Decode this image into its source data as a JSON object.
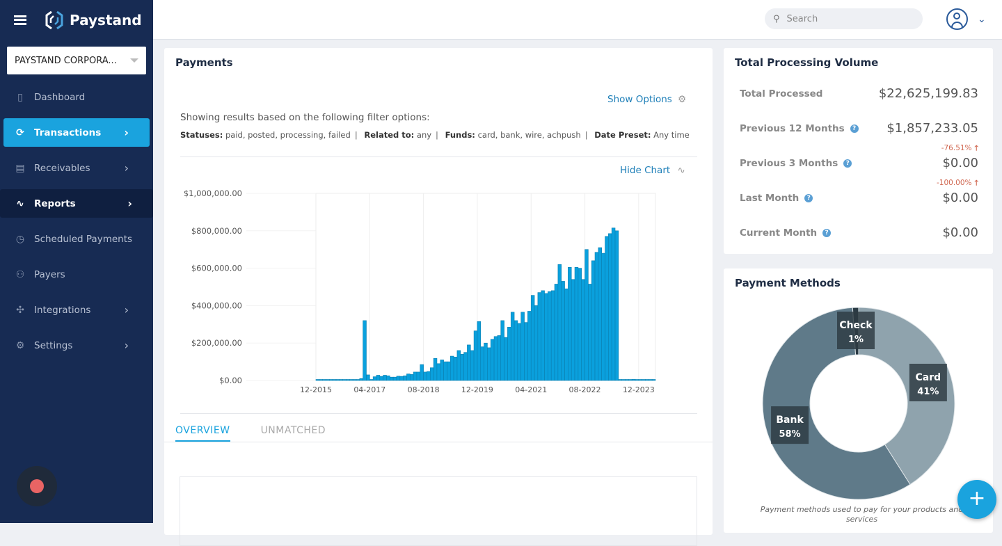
{
  "app": {
    "brand": "Paystand"
  },
  "sidebar": {
    "org_selector": "PAYSTAND CORPORA...",
    "items": [
      {
        "label": "Dashboard",
        "icon": "dashboard-icon"
      },
      {
        "label": "Transactions",
        "icon": "refresh-icon",
        "active": true
      },
      {
        "label": "Receivables",
        "icon": "document-icon"
      },
      {
        "label": "Reports",
        "icon": "activity-icon"
      },
      {
        "label": "Scheduled Payments",
        "icon": "clock-icon"
      },
      {
        "label": "Payers",
        "icon": "users-icon"
      },
      {
        "label": "Integrations",
        "icon": "puzzle-icon"
      },
      {
        "label": "Settings",
        "icon": "gear-icon"
      }
    ]
  },
  "topbar": {
    "search_placeholder": "Search"
  },
  "payments": {
    "title": "Payments",
    "show_options": "Show Options",
    "filter_intro": "Showing results based on the following filter options:",
    "filters": [
      {
        "key": "Statuses:",
        "value": "paid, posted, processing, failed"
      },
      {
        "key": "Related to:",
        "value": "any"
      },
      {
        "key": "Funds:",
        "value": "card, bank, wire, achpush"
      },
      {
        "key": "Date Preset:",
        "value": "Any time"
      }
    ],
    "hide_chart": "Hide Chart",
    "tabs": [
      {
        "label": "OVERVIEW",
        "active": true
      },
      {
        "label": "UNMATCHED"
      }
    ]
  },
  "tpv": {
    "title": "Total Processing Volume",
    "rows": [
      {
        "label": "Total Processed",
        "value": "$22,625,199.83"
      },
      {
        "label": "Previous 12 Months",
        "value": "$1,857,233.05",
        "change": "-76.51%"
      },
      {
        "label": "Previous 3 Months",
        "value": "$0.00",
        "change": "-100.00%"
      },
      {
        "label": "Last Month",
        "value": "$0.00"
      },
      {
        "label": "Current Month",
        "value": "$0.00"
      }
    ]
  },
  "payment_methods": {
    "title": "Payment Methods",
    "caption": "Payment methods used to pay for your products and services"
  },
  "colors": {
    "accent": "#1aa3de",
    "sidebar": "#172b53",
    "bar": "#0aa0dd",
    "negative": "#d0664f"
  },
  "chart_data": [
    {
      "type": "bar",
      "ylim": [
        0,
        1000000
      ],
      "y_ticks": [
        "$0.00",
        "$200,000.00",
        "$400,000.00",
        "$600,000.00",
        "$800,000.00",
        "$1,000,000.00"
      ],
      "x_ticks": [
        "12-2015",
        "04-2017",
        "08-2018",
        "12-2019",
        "04-2021",
        "08-2022",
        "12-2023"
      ],
      "grid": true,
      "categories": [
        "12-2015",
        "01-2016",
        "02-2016",
        "03-2016",
        "04-2016",
        "05-2016",
        "06-2016",
        "07-2016",
        "08-2016",
        "09-2016",
        "10-2016",
        "11-2016",
        "12-2016",
        "01-2017",
        "02-2017",
        "03-2017",
        "04-2017",
        "05-2017",
        "06-2017",
        "07-2017",
        "08-2017",
        "09-2017",
        "10-2017",
        "11-2017",
        "12-2017",
        "01-2018",
        "02-2018",
        "03-2018",
        "04-2018",
        "05-2018",
        "06-2018",
        "07-2018",
        "08-2018",
        "09-2018",
        "10-2018",
        "11-2018",
        "12-2018",
        "01-2019",
        "02-2019",
        "03-2019",
        "04-2019",
        "05-2019",
        "06-2019",
        "07-2019",
        "08-2019",
        "09-2019",
        "10-2019",
        "11-2019",
        "12-2019",
        "01-2020",
        "02-2020",
        "03-2020",
        "04-2020",
        "05-2020",
        "06-2020",
        "07-2020",
        "08-2020",
        "09-2020",
        "10-2020",
        "11-2020",
        "12-2020",
        "01-2021",
        "02-2021",
        "03-2021",
        "04-2021",
        "05-2021",
        "06-2021",
        "07-2021",
        "08-2021",
        "09-2021",
        "10-2021",
        "11-2021",
        "12-2021",
        "01-2022",
        "02-2022",
        "03-2022",
        "04-2022",
        "05-2022",
        "06-2022",
        "07-2022",
        "08-2022",
        "09-2022",
        "10-2022",
        "11-2022",
        "12-2022",
        "01-2023",
        "02-2023",
        "03-2023",
        "04-2023",
        "05-2023",
        "06-2023",
        "07-2023",
        "08-2023",
        "09-2023",
        "10-2023",
        "11-2023",
        "12-2023",
        "01-2024",
        "02-2024",
        "03-2024",
        "04-2024"
      ],
      "values": [
        0,
        0,
        0,
        0,
        0,
        0,
        0,
        0,
        0,
        0,
        0,
        0,
        0,
        10000,
        320000,
        30000,
        5000,
        20000,
        28000,
        22000,
        28000,
        25000,
        18000,
        18000,
        23000,
        22000,
        25000,
        35000,
        32000,
        45000,
        45000,
        85000,
        45000,
        48000,
        68000,
        118000,
        90000,
        110000,
        100000,
        100000,
        130000,
        125000,
        160000,
        140000,
        150000,
        190000,
        160000,
        265000,
        315000,
        180000,
        200000,
        175000,
        220000,
        235000,
        240000,
        320000,
        230000,
        285000,
        365000,
        320000,
        305000,
        365000,
        310000,
        370000,
        455000,
        400000,
        470000,
        480000,
        465000,
        475000,
        480000,
        515000,
        620000,
        530000,
        490000,
        605000,
        540000,
        605000,
        600000,
        540000,
        700000,
        515000,
        640000,
        685000,
        710000,
        680000,
        770000,
        785000,
        815000,
        800000,
        0,
        0,
        0,
        0,
        6000,
        0,
        0,
        0,
        0,
        0,
        0
      ]
    },
    {
      "type": "pie",
      "slices": [
        {
          "label": "Card",
          "value": 41,
          "display": "41%",
          "color": "#8fa3ad"
        },
        {
          "label": "Bank",
          "value": 58,
          "display": "58%",
          "color": "#5f7a89"
        },
        {
          "label": "Check",
          "value": 1,
          "display": "1%",
          "color": "#2a3a44"
        }
      ]
    }
  ]
}
